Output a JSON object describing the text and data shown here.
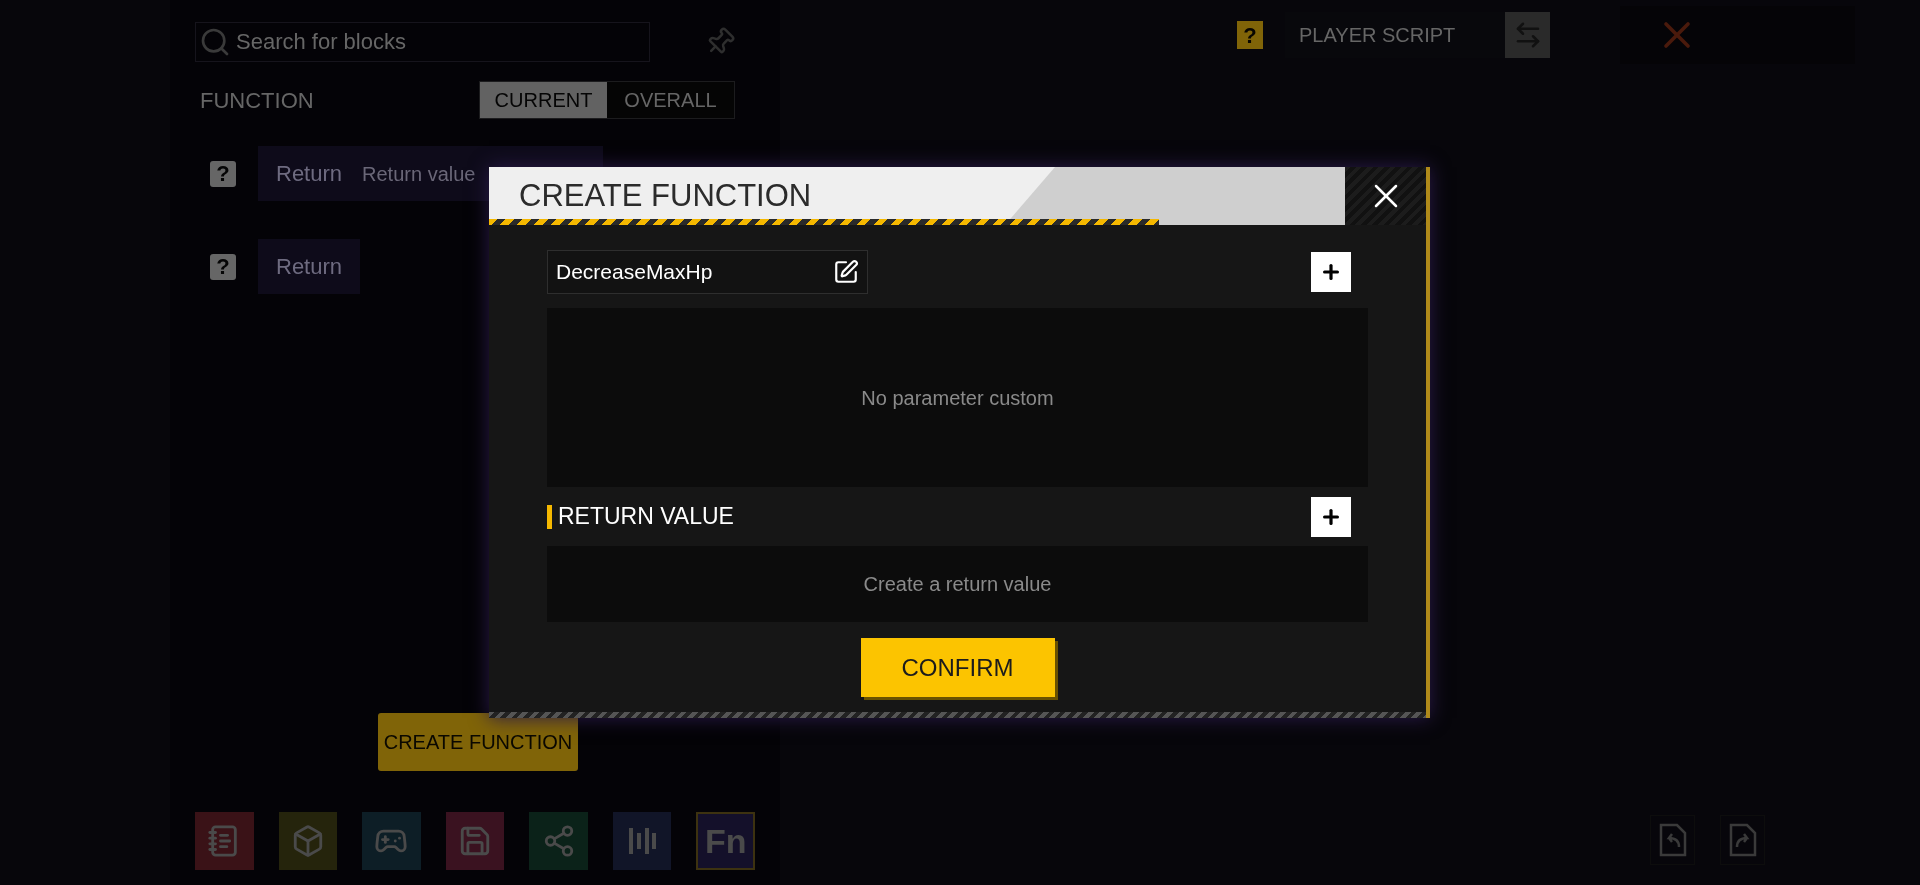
{
  "sidebar": {
    "search": {
      "placeholder": "Search for blocks"
    },
    "section_title": "FUNCTION",
    "tabs": [
      {
        "label": "CURRENT",
        "selected": true
      },
      {
        "label": "OVERALL",
        "selected": false
      }
    ],
    "blocks": [
      {
        "badge": "?",
        "label": "Return",
        "parameter": "Return value"
      },
      {
        "badge": "?",
        "label": "Return"
      }
    ],
    "create_button": "CREATE FUNCTION"
  },
  "toolbar": {
    "items": [
      {
        "kind": "notes",
        "color": "#3a1217",
        "selected": false
      },
      {
        "kind": "box",
        "color": "#25240c",
        "selected": false
      },
      {
        "kind": "gamepad",
        "color": "#0d1e26",
        "selected": false
      },
      {
        "kind": "save",
        "color": "#3a1220",
        "selected": false
      },
      {
        "kind": "share",
        "color": "#0b2219",
        "selected": false
      },
      {
        "kind": "bars",
        "color": "#111528",
        "selected": false
      },
      {
        "kind": "text",
        "label": "Fn",
        "color": "#14102a",
        "selected": true
      }
    ]
  },
  "header": {
    "help": "?",
    "script_label": "PLAYER SCRIPT"
  },
  "dialog": {
    "title": "CREATE FUNCTION",
    "name": "DecreaseMaxHp",
    "parameters_empty": "No parameter custom",
    "return_section": "RETURN VALUE",
    "return_empty": "Create a return value",
    "confirm": "CONFIRM"
  }
}
